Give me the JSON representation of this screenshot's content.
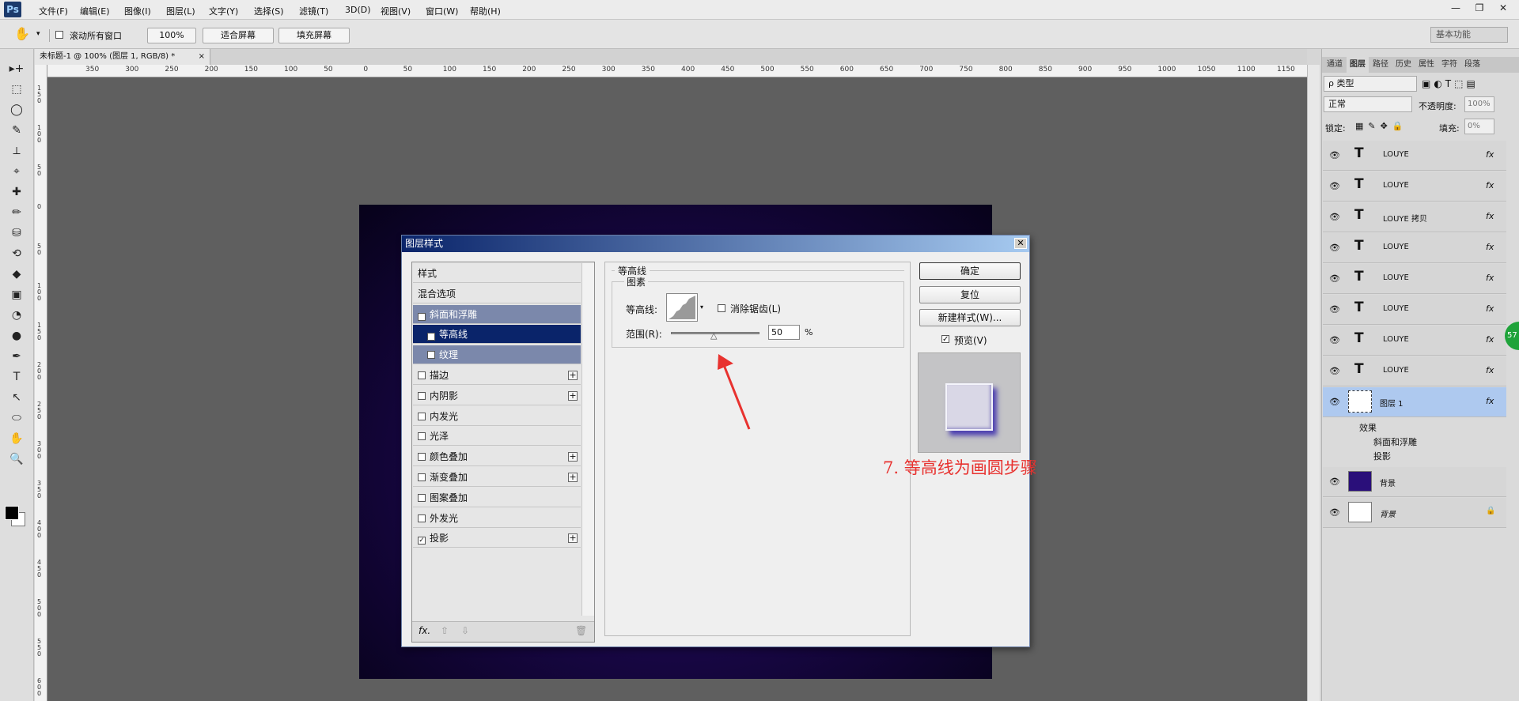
{
  "app": {
    "logo": "Ps"
  },
  "menu": [
    "文件(F)",
    "编辑(E)",
    "图像(I)",
    "图层(L)",
    "文字(Y)",
    "选择(S)",
    "滤镜(T)",
    "3D(D)",
    "视图(V)",
    "窗口(W)",
    "帮助(H)"
  ],
  "window_controls": {
    "minimize": "—",
    "restore": "❐",
    "close": "✕"
  },
  "options": {
    "scroll_all_label": "滚动所有窗口",
    "zoom_value": "100%",
    "fit_screen": "适合屏幕",
    "fill_screen": "填充屏幕",
    "workspace": "基本功能"
  },
  "document": {
    "tab_title": "未标题-1 @ 100% (图层 1, RGB/8) *",
    "tab_close": "×"
  },
  "rulers": {
    "h_ticks": [
      "350",
      "300",
      "250",
      "200",
      "150",
      "100",
      "50",
      "0",
      "50",
      "100",
      "150",
      "200",
      "250",
      "300",
      "350",
      "400",
      "450",
      "500",
      "550",
      "600",
      "650",
      "700",
      "750",
      "800",
      "850",
      "900",
      "950",
      "1000",
      "1050",
      "1100",
      "1150"
    ],
    "v_ticks": [
      "150",
      "100",
      "50",
      "0",
      "50",
      "100",
      "150",
      "200",
      "250",
      "300",
      "350",
      "400",
      "450",
      "500",
      "550",
      "600"
    ]
  },
  "toolbar": {
    "tools": [
      "▸+",
      "⬚",
      "◯",
      "✎",
      "⟂",
      "⌖",
      "✚",
      "✏",
      "⛁",
      "⟲",
      "◆",
      "▣",
      "◔",
      "●",
      "✒",
      "T",
      "↖",
      "⬭",
      "✋",
      "🔍"
    ]
  },
  "panel": {
    "tabs": [
      "通道",
      "图层",
      "路径",
      "历史",
      "属性",
      "字符",
      "段落"
    ],
    "active_tab": "图层",
    "filter_kind": "ρ 类型",
    "blend_mode": "正常",
    "opacity_label": "不透明度:",
    "opacity_value": "100%",
    "lock_label": "锁定:",
    "fill_label": "填充:",
    "fill_value": "0%",
    "layers": [
      {
        "name": "LOUYE",
        "type": "text",
        "fx": "fx"
      },
      {
        "name": "LOUYE",
        "type": "text",
        "fx": "fx"
      },
      {
        "name": "LOUYE 拷贝",
        "type": "text",
        "fx": "fx"
      },
      {
        "name": "LOUYE",
        "type": "text",
        "fx": "fx"
      },
      {
        "name": "LOUYE",
        "type": "text",
        "fx": "fx"
      },
      {
        "name": "LOUYE",
        "type": "text",
        "fx": "fx"
      },
      {
        "name": "LOUYE",
        "type": "text",
        "fx": "fx"
      },
      {
        "name": "LOUYE",
        "type": "text",
        "fx": "fx"
      }
    ],
    "selected_layer": {
      "name": "图层 1",
      "fx": "fx"
    },
    "effects_label": "效果",
    "effects": [
      "斜面和浮雕",
      "投影"
    ],
    "bg_layers": [
      {
        "name": "背景"
      },
      {
        "name": "背景"
      }
    ],
    "text_icon": "T",
    "badge": "57"
  },
  "dialog": {
    "title": "图层样式",
    "close": "✕",
    "styles": [
      {
        "label": "样式",
        "checkbox": false,
        "checked": false,
        "plus": false,
        "state": "normal"
      },
      {
        "label": "混合选项",
        "checkbox": false,
        "checked": false,
        "plus": false,
        "state": "normal"
      },
      {
        "label": "斜面和浮雕",
        "checkbox": true,
        "checked": true,
        "plus": false,
        "state": "highlight"
      },
      {
        "label": "等高线",
        "checkbox": true,
        "checked": true,
        "plus": false,
        "state": "selected",
        "indent": true
      },
      {
        "label": "纹理",
        "checkbox": true,
        "checked": false,
        "plus": false,
        "state": "highlight",
        "indent": true
      },
      {
        "label": "描边",
        "checkbox": true,
        "checked": false,
        "plus": true,
        "state": "normal"
      },
      {
        "label": "内阴影",
        "checkbox": true,
        "checked": false,
        "plus": true,
        "state": "normal"
      },
      {
        "label": "内发光",
        "checkbox": true,
        "checked": false,
        "plus": false,
        "state": "normal"
      },
      {
        "label": "光泽",
        "checkbox": true,
        "checked": false,
        "plus": false,
        "state": "normal"
      },
      {
        "label": "颜色叠加",
        "checkbox": true,
        "checked": false,
        "plus": true,
        "state": "normal"
      },
      {
        "label": "渐变叠加",
        "checkbox": true,
        "checked": false,
        "plus": true,
        "state": "normal"
      },
      {
        "label": "图案叠加",
        "checkbox": true,
        "checked": false,
        "plus": false,
        "state": "normal"
      },
      {
        "label": "外发光",
        "checkbox": true,
        "checked": false,
        "plus": false,
        "state": "normal"
      },
      {
        "label": "投影",
        "checkbox": true,
        "checked": true,
        "plus": true,
        "state": "normal"
      }
    ],
    "fx_label": "fx.",
    "group_title": "等高线",
    "subgroup_title": "图素",
    "contour_label": "等高线:",
    "antialias_label": "消除锯齿(L)",
    "range_label": "范围(R):",
    "range_value": "50",
    "range_fraction": 0.5,
    "percent": "%",
    "ok": "确定",
    "reset": "复位",
    "new_style": "新建样式(W)...",
    "preview_label": "预览(V)"
  },
  "annotation": "7. 等高线为画圆步骤"
}
